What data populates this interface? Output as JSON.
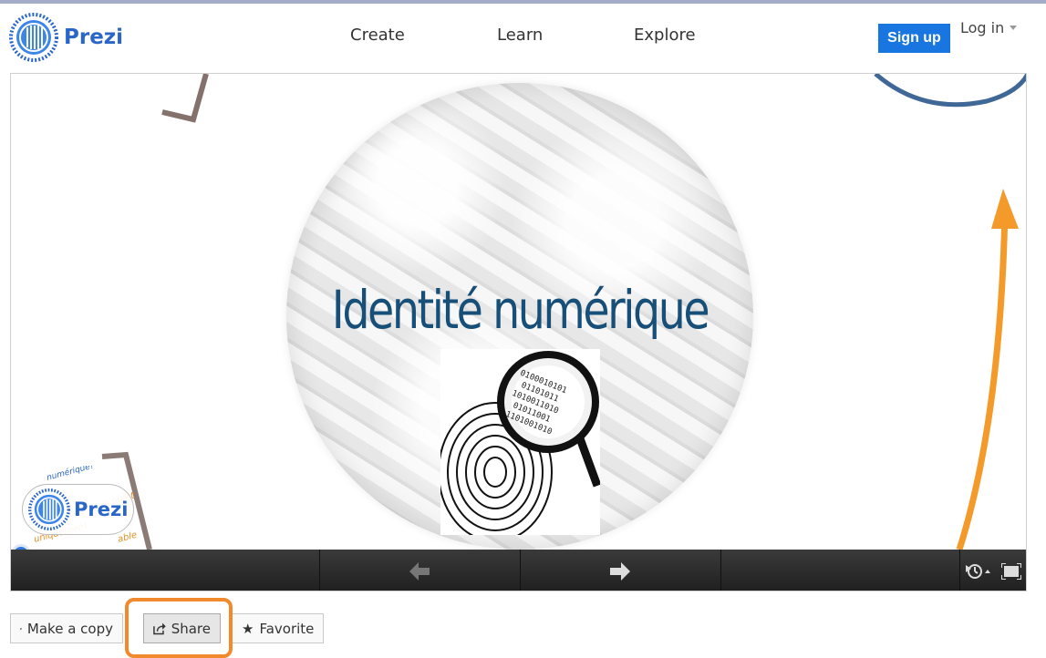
{
  "header": {
    "logo_text": "Prezi",
    "nav": [
      "Create",
      "Learn",
      "Explore"
    ],
    "signup_label": "Sign up",
    "login_label": "Log in"
  },
  "presentation": {
    "title": "Identité numérique",
    "mini_logo_text": "Prezi",
    "binary_text": [
      "0100010101",
      "01101011",
      "1010011010",
      "01011001",
      "1101001010"
    ],
    "corner_fragments": [
      "numérique?",
      "un objet",
      "uniquement",
      "able"
    ]
  },
  "actions": {
    "make_copy": "Make a copy",
    "share": "Share",
    "favorite": "Favorite"
  },
  "colors": {
    "brand": "#2a66c7",
    "signup": "#1976e0",
    "title": "#174f78",
    "accent_arrow": "#f39a2a",
    "highlight": "#f08a2c"
  },
  "icons": {
    "prev": "arrow-left-icon",
    "next": "arrow-right-icon",
    "autoplay": "autoplay-icon",
    "fullscreen": "fullscreen-icon"
  }
}
